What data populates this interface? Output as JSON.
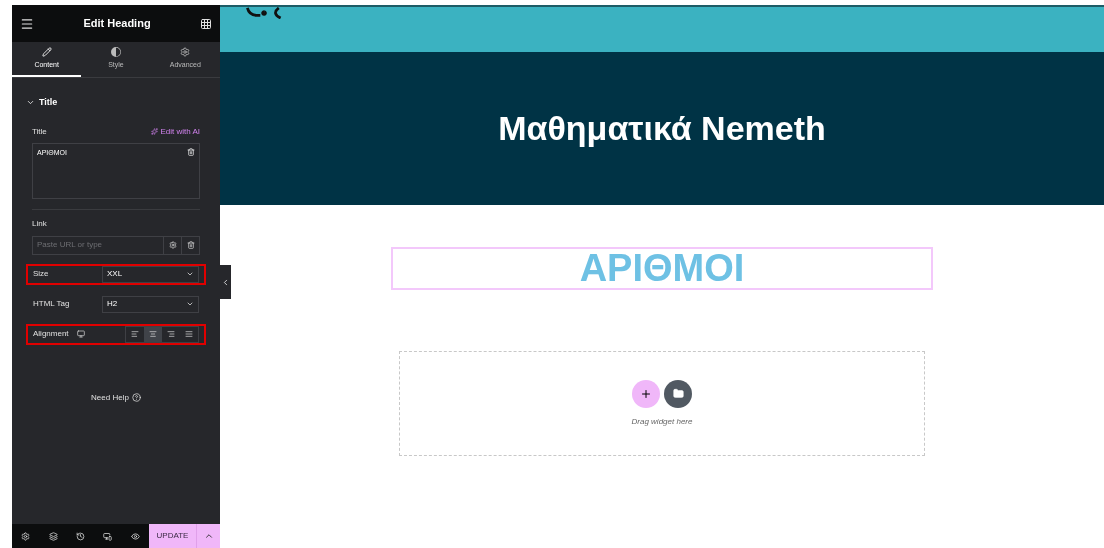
{
  "panel": {
    "title": "Edit Heading",
    "tabs": [
      {
        "label": "Content",
        "kind": "pencil",
        "selected": true
      },
      {
        "label": "Style",
        "kind": "contrast",
        "selected": false
      },
      {
        "label": "Advanced",
        "kind": "gear",
        "selected": false
      }
    ],
    "section": {
      "title": "Title",
      "expanded": true
    },
    "title_field": {
      "label": "Title",
      "ai_link": "Edit with AI",
      "value": "ΑΡΙΘΜΟΙ"
    },
    "link_field": {
      "label": "Link",
      "placeholder": "Paste URL or type"
    },
    "size": {
      "label": "Size",
      "value": "XXL",
      "highlighted": true
    },
    "html_tag": {
      "label": "HTML Tag",
      "value": "H2",
      "highlighted": false
    },
    "alignment": {
      "label": "Alignment",
      "highlighted": true,
      "options": [
        {
          "kind": "left",
          "selected": false
        },
        {
          "kind": "center",
          "selected": true
        },
        {
          "kind": "right",
          "selected": false
        },
        {
          "kind": "justify",
          "selected": false
        }
      ]
    },
    "help": "Need Help",
    "footer": {
      "update": "UPDATE"
    }
  },
  "canvas": {
    "page_title": "Μαθηματικά Nemeth",
    "heading": "ΑΡΙΘΜΟΙ",
    "dropzone": "Drag widget here"
  }
}
